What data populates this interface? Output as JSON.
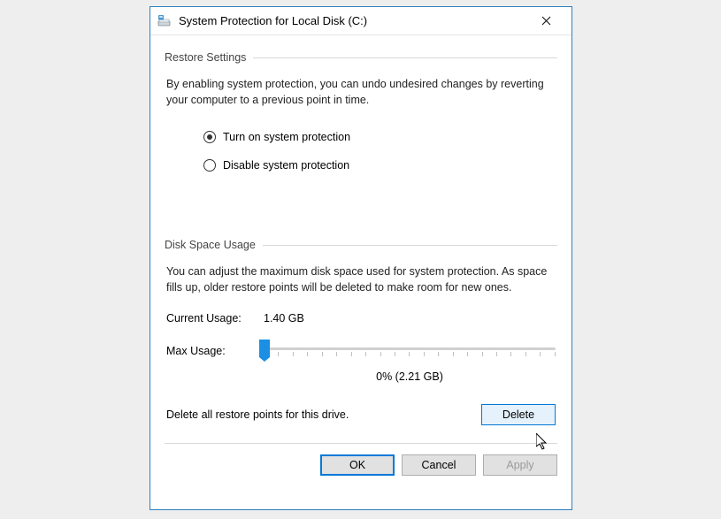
{
  "dialog": {
    "title": "System Protection for Local Disk (C:)"
  },
  "restore": {
    "heading": "Restore Settings",
    "description": "By enabling system protection, you can undo undesired changes by reverting your computer to a previous point in time.",
    "options": {
      "enable": "Turn on system protection",
      "disable": "Disable system protection"
    },
    "selected": "enable"
  },
  "disk": {
    "heading": "Disk Space Usage",
    "description": "You can adjust the maximum disk space used for system protection. As space fills up, older restore points will be deleted to make room for new ones.",
    "current_label": "Current Usage:",
    "current_value": "1.40 GB",
    "max_label": "Max Usage:",
    "slider_value": "0% (2.21 GB)",
    "delete_text": "Delete all restore points for this drive.",
    "delete_button": "Delete"
  },
  "buttons": {
    "ok": "OK",
    "cancel": "Cancel",
    "apply": "Apply"
  }
}
